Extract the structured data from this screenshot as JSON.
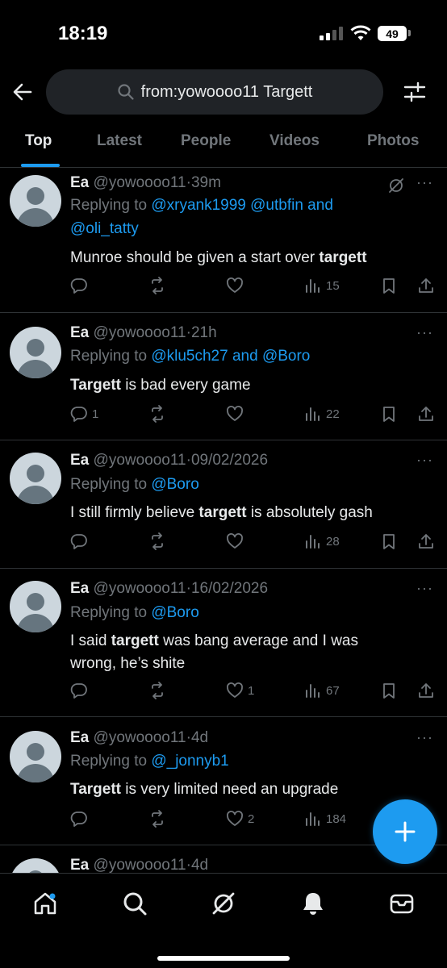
{
  "status_bar": {
    "time": "18:19",
    "battery": "49"
  },
  "search": {
    "query": "from:yowoooo11 Targett"
  },
  "tabs": [
    {
      "label": "Top",
      "active": true
    },
    {
      "label": "Latest"
    },
    {
      "label": "People"
    },
    {
      "label": "Videos"
    },
    {
      "label": "Photos"
    }
  ],
  "tweets": [
    {
      "name": "Ea",
      "handle": "@yowoooo11",
      "time": "39m",
      "replying_prefix": "Replying to ",
      "mentions": "@xryank1999 @utbfin and",
      "mentions2": "@oli_tatty",
      "text_pre": "Munroe should be given a start over ",
      "text_bold": "targett",
      "text_post": "",
      "replies": "",
      "likes": "",
      "views": "15"
    },
    {
      "name": "Ea",
      "handle": "@yowoooo11",
      "time": "21h",
      "replying_prefix": "Replying to ",
      "mentions": "@klu5ch27 and @Boro",
      "text_pre": "",
      "text_bold": "Targett",
      "text_post": " is bad every game",
      "replies": "1",
      "likes": "",
      "views": "22"
    },
    {
      "name": "Ea",
      "handle": "@yowoooo11",
      "time": "09/02/2026",
      "replying_prefix": "Replying to ",
      "mentions": "@Boro",
      "text_pre": "I still firmly believe ",
      "text_bold": "targett",
      "text_post": " is absolutely gash",
      "replies": "",
      "likes": "",
      "views": "28"
    },
    {
      "name": "Ea",
      "handle": "@yowoooo11",
      "time": "16/02/2026",
      "replying_prefix": "Replying to ",
      "mentions": "@Boro",
      "text_pre": "I said ",
      "text_bold": "targett",
      "text_post": " was bang average and I was wrong, he’s shite",
      "replies": "",
      "likes": "1",
      "views": "67"
    },
    {
      "name": "Ea",
      "handle": "@yowoooo11",
      "time": "4d",
      "replying_prefix": "Replying to ",
      "mentions": "@_jonnyb1",
      "text_pre": "",
      "text_bold": "Targett",
      "text_post": " is very limited need an upgrade",
      "replies": "",
      "likes": "2",
      "views": "184"
    },
    {
      "name": "Ea",
      "handle": "@yowoooo11",
      "time": "4d"
    }
  ],
  "dot_sep": "·",
  "colors": {
    "accent": "#1d9bf0",
    "background": "#000000",
    "muted": "#71767b"
  }
}
